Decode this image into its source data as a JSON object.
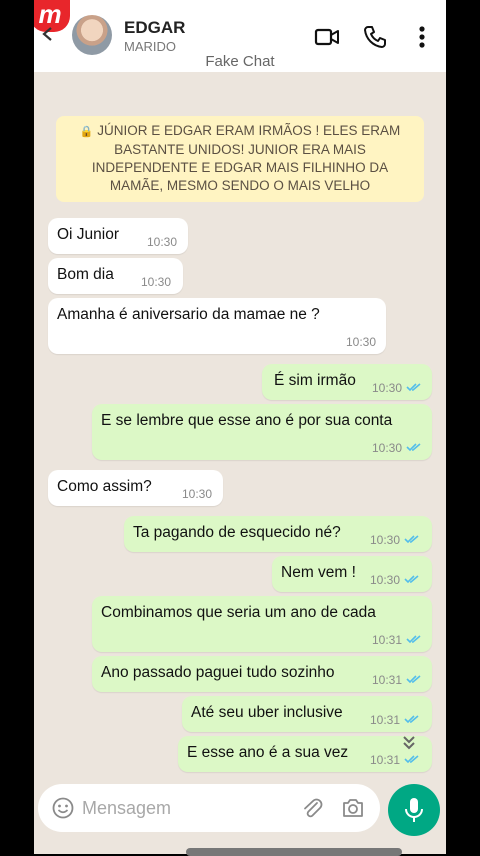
{
  "header": {
    "app_badge": "m",
    "contact_name": "EDGAR",
    "contact_status": "MARIDO",
    "watermark": "Fake Chat"
  },
  "system_note": {
    "lock": "🔒",
    "text": "JÚNIOR E EDGAR ERAM IRMÃOS ! ELES ERAM BASTANTE UNIDOS! JUNIOR ERA MAIS INDEPENDENTE E EDGAR MAIS FILHINHO DA MAMÃE, MESMO SENDO O MAIS VELHO"
  },
  "messages": [
    {
      "dir": "in",
      "text": "Oi Junior",
      "time": "10:30"
    },
    {
      "dir": "in",
      "text": "Bom dia",
      "time": "10:30"
    },
    {
      "dir": "in",
      "text": "Amanha é aniversario da mamae ne ?",
      "time": "10:30"
    },
    {
      "dir": "out",
      "text": "É sim irmão",
      "time": "10:30"
    },
    {
      "dir": "out",
      "text": "E se lembre que esse ano é por sua conta",
      "time": "10:30"
    },
    {
      "dir": "in",
      "text": "Como assim?",
      "time": "10:30"
    },
    {
      "dir": "out",
      "text": "Ta pagando de esquecido né?",
      "time": "10:30"
    },
    {
      "dir": "out",
      "text": "Nem vem !",
      "time": "10:30"
    },
    {
      "dir": "out",
      "text": "Combinamos que seria um ano de cada",
      "time": "10:31"
    },
    {
      "dir": "out",
      "text": "Ano passado paguei tudo sozinho",
      "time": "10:31"
    },
    {
      "dir": "out",
      "text": "Até seu uber inclusive",
      "time": "10:31"
    },
    {
      "dir": "out",
      "text": "E esse ano é a sua vez",
      "time": "10:31"
    }
  ],
  "composer": {
    "placeholder": "Mensagem"
  },
  "colors": {
    "incoming": "#ffffff",
    "outgoing": "#dcf8c6",
    "read_ticks": "#53bdeb",
    "mic_button": "#00a884",
    "system_note": "#fff4c2"
  },
  "icons": [
    "back-icon",
    "video-call-icon",
    "phone-icon",
    "menu-icon",
    "lock-icon",
    "read-ticks-icon",
    "scroll-down-icon",
    "emoji-icon",
    "attach-icon",
    "camera-icon",
    "mic-icon"
  ]
}
